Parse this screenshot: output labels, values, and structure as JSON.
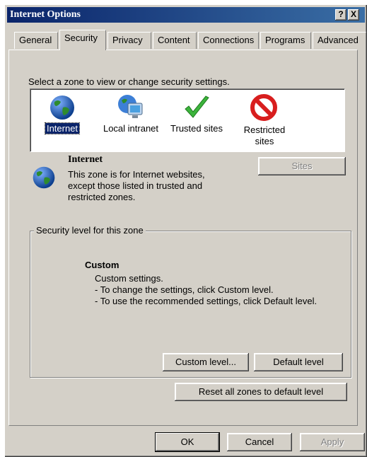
{
  "window": {
    "title": "Internet Options",
    "help_button": "?",
    "close_button": "X"
  },
  "tabs": [
    {
      "label": "General"
    },
    {
      "label": "Security"
    },
    {
      "label": "Privacy"
    },
    {
      "label": "Content"
    },
    {
      "label": "Connections"
    },
    {
      "label": "Programs"
    },
    {
      "label": "Advanced"
    }
  ],
  "security": {
    "instruction": "Select a zone to view or change security settings.",
    "zones": [
      {
        "label": "Internet",
        "icon": "globe-icon"
      },
      {
        "label": "Local intranet",
        "icon": "intranet-icon"
      },
      {
        "label": "Trusted sites",
        "icon": "checkmark-icon"
      },
      {
        "label": "Restricted sites",
        "icon": "restricted-icon"
      }
    ],
    "selected_zone": {
      "name": "Internet",
      "description": "This zone is for Internet websites, except those listed in trusted and restricted zones."
    },
    "sites_button": "Sites",
    "level_group": {
      "legend": "Security level for this zone",
      "level_name": "Custom",
      "line1": "Custom settings.",
      "line2": "- To change the settings, click Custom level.",
      "line3": "- To use the recommended settings, click Default level."
    },
    "custom_level_button": "Custom level...",
    "default_level_button": "Default level",
    "reset_button": "Reset all zones to default level"
  },
  "footer": {
    "ok": "OK",
    "cancel": "Cancel",
    "apply": "Apply"
  },
  "colors": {
    "face": "#d4d0c8",
    "title_start": "#0a246a",
    "title_end": "#3a6ea5"
  }
}
